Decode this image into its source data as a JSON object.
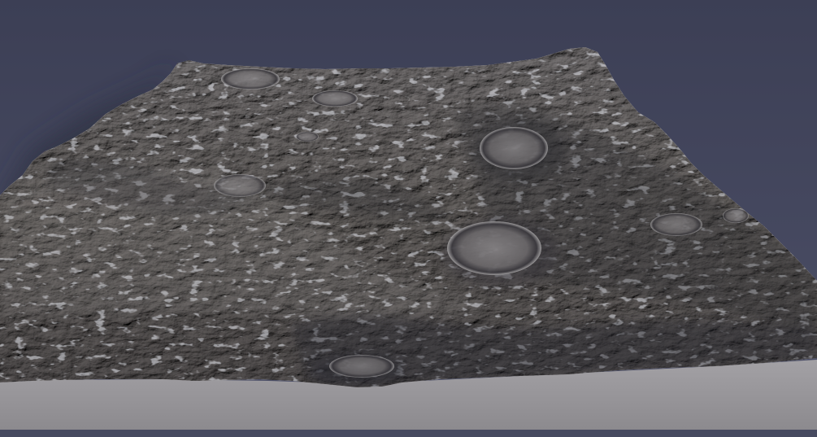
{
  "scene": {
    "subject": "",
    "colors": {
      "background_top": "#3c3f55",
      "background_bottom": "#4d5068",
      "terrain_base": "#7d7a78",
      "terrain_light": "#a8a6a6",
      "terrain_dark": "#3f3d41",
      "terrain_shadow": "#2b2a33",
      "frost": "#c7cbd8",
      "ground_plane": "#9e9ca0",
      "ground_plane_dark": "#8b898d",
      "cast_shadow": "#2e3042"
    }
  }
}
